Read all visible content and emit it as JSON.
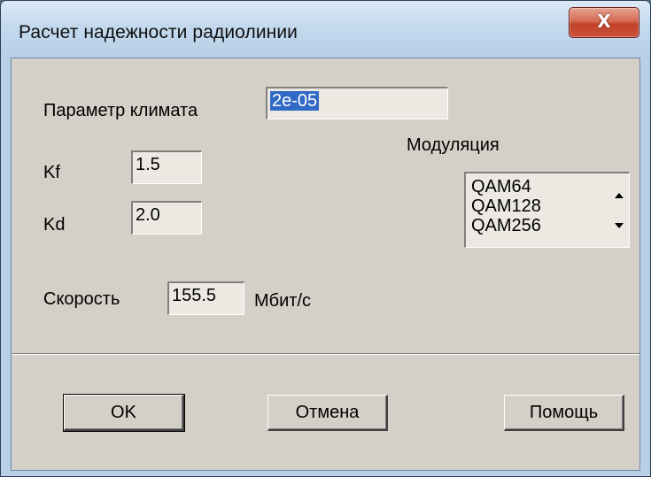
{
  "window": {
    "title": "Расчет надежности радиолинии",
    "close_glyph": "X"
  },
  "climate": {
    "label": "Параметр климата",
    "value": "2e-05"
  },
  "kf": {
    "label": "Kf",
    "value": "1.5"
  },
  "kd": {
    "label": "Kd",
    "value": "2.0"
  },
  "modulation": {
    "label": "Модуляция",
    "options": [
      "QAM64",
      "QAM128",
      "QAM256"
    ]
  },
  "speed": {
    "label": "Скорость",
    "value": "155.5",
    "unit": "Мбит/с"
  },
  "buttons": {
    "ok": "OK",
    "cancel": "Отмена",
    "help": "Помощь"
  }
}
